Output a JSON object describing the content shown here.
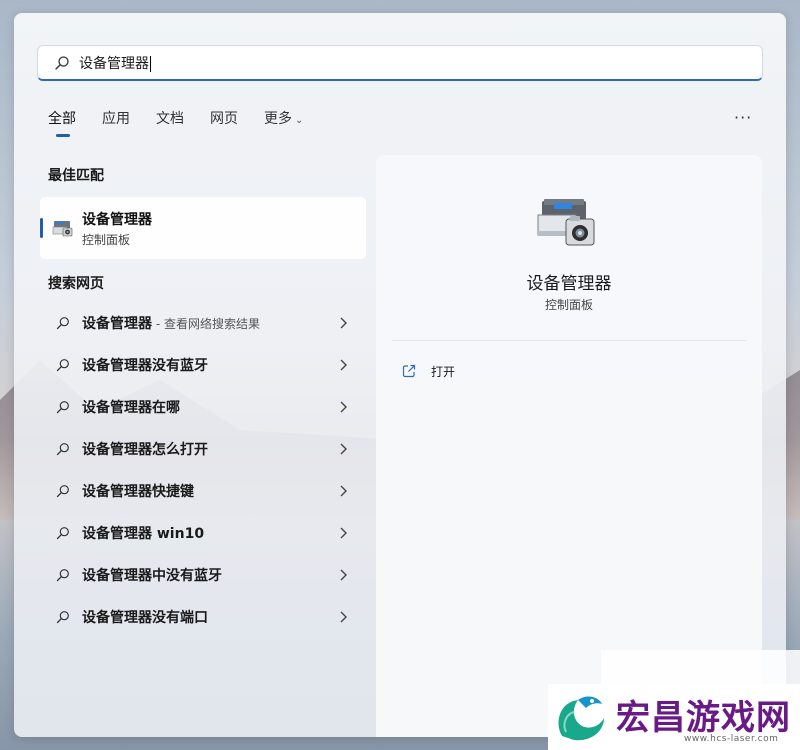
{
  "search": {
    "query": "设备管理器"
  },
  "tabs": [
    {
      "label": "全部"
    },
    {
      "label": "应用"
    },
    {
      "label": "文档"
    },
    {
      "label": "网页"
    },
    {
      "label": "更多"
    }
  ],
  "more_options_label": "···",
  "best_match": {
    "section_title": "最佳匹配",
    "title": "设备管理器",
    "subtitle": "控制面板"
  },
  "web_search": {
    "section_title": "搜索网页",
    "first_item": {
      "label": "设备管理器",
      "suffix": " - 查看网络搜索结果"
    },
    "items": [
      "设备管理器没有蓝牙",
      "设备管理器在哪",
      "设备管理器怎么打开",
      "设备管理器快捷键",
      "设备管理器 win10",
      "设备管理器中没有蓝牙",
      "设备管理器没有端口"
    ]
  },
  "preview": {
    "title": "设备管理器",
    "subtitle": "控制面板",
    "actions": [
      {
        "label": "打开"
      }
    ]
  },
  "watermark": {
    "title": "宏昌游戏网",
    "url": "www.hcs-laser.com"
  },
  "colors": {
    "accent": "#1f5fa8",
    "watermark": "#6a1a86"
  }
}
